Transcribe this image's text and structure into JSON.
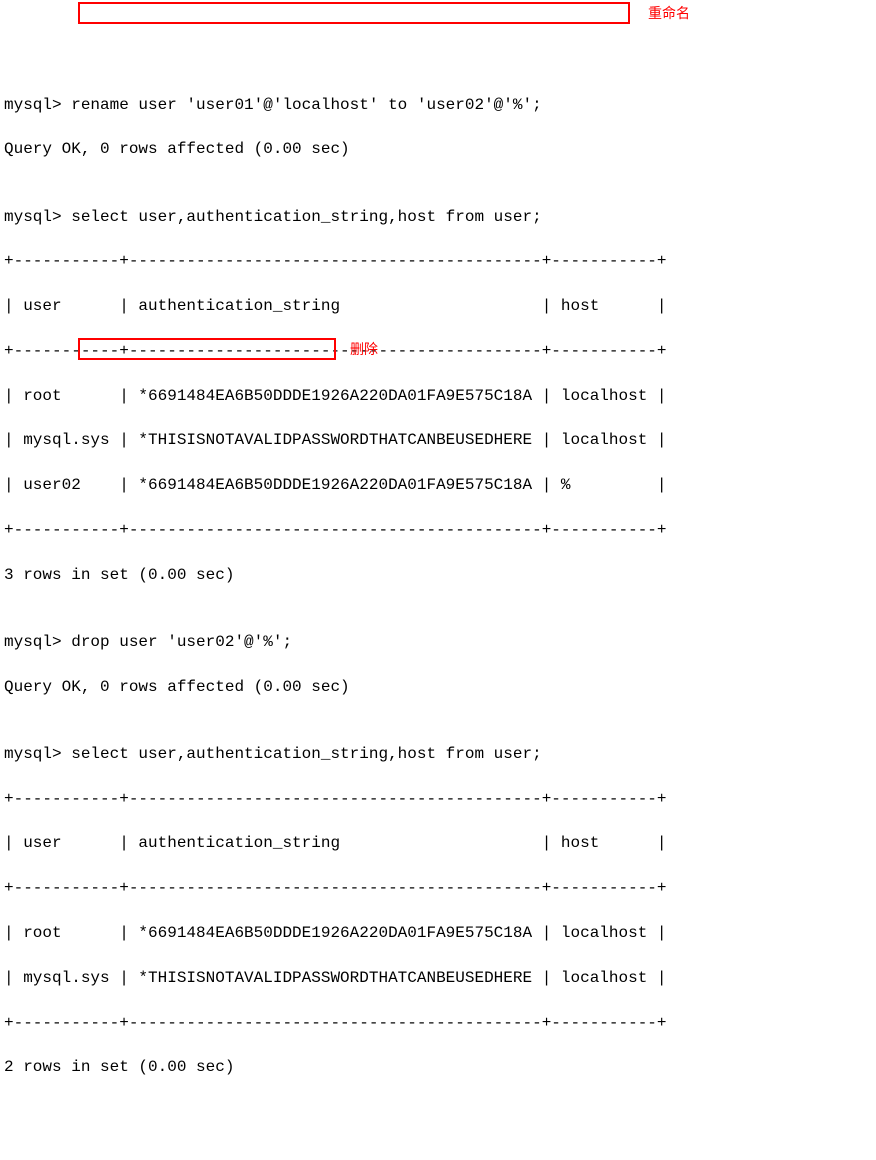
{
  "annotations": {
    "rename_label": "重命名",
    "drop_label": "删除"
  },
  "lines": {
    "l0": "mysql> rename user 'user01'@'localhost' to 'user02'@'%';",
    "l1": "Query OK, 0 rows affected (0.00 sec)",
    "l2": "",
    "l3": "mysql> select user,authentication_string,host from user;",
    "l4": "+-----------+-------------------------------------------+-----------+",
    "l5": "| user      | authentication_string                     | host      |",
    "l6": "+-----------+-------------------------------------------+-----------+",
    "l7": "| root      | *6691484EA6B50DDDE1926A220DA01FA9E575C18A | localhost |",
    "l8": "| mysql.sys | *THISISNOTAVALIDPASSWORDTHATCANBEUSEDHERE | localhost |",
    "l9": "| user02    | *6691484EA6B50DDDE1926A220DA01FA9E575C18A | %         |",
    "l10": "+-----------+-------------------------------------------+-----------+",
    "l11": "3 rows in set (0.00 sec)",
    "l12": "",
    "l13": "mysql> drop user 'user02'@'%';",
    "l14": "Query OK, 0 rows affected (0.00 sec)",
    "l15": "",
    "l16": "mysql> select user,authentication_string,host from user;",
    "l17": "+-----------+-------------------------------------------+-----------+",
    "l18": "| user      | authentication_string                     | host      |",
    "l19": "+-----------+-------------------------------------------+-----------+",
    "l20": "| root      | *6691484EA6B50DDDE1926A220DA01FA9E575C18A | localhost |",
    "l21": "| mysql.sys | *THISISNOTAVALIDPASSWORDTHATCANBEUSEDHERE | localhost |",
    "l22": "+-----------+-------------------------------------------+-----------+",
    "l23": "2 rows in set (0.00 sec)"
  }
}
